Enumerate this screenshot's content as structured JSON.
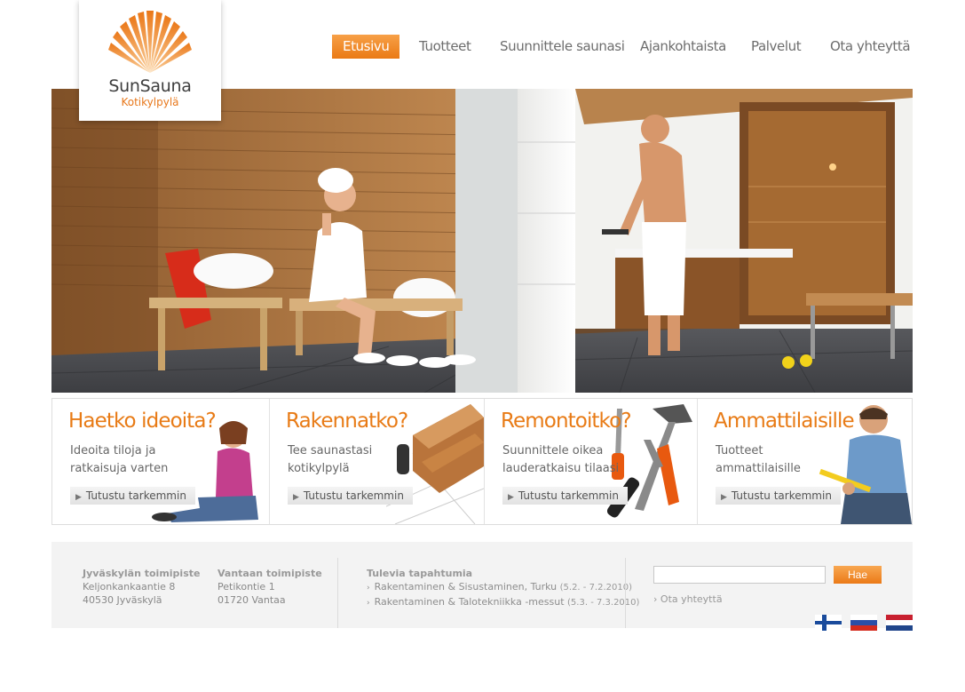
{
  "logo": {
    "brand": "SunSauna",
    "subtitle": "Kotikylpylä",
    "icon": "sun-fan-icon",
    "accent": "#ef8a26"
  },
  "nav": {
    "items": [
      {
        "label": "Etusivu",
        "active": true
      },
      {
        "label": "Tuotteet"
      },
      {
        "label": "Suunnittele saunasi"
      },
      {
        "label": "Ajankohtaista"
      },
      {
        "label": "Palvelut"
      },
      {
        "label": "Ota yhteyttä"
      }
    ]
  },
  "teasers": [
    {
      "title": "Haetko ideoita?",
      "desc_line1": "Ideoita tiloja ja",
      "desc_line2": "ratkaisuja varten",
      "button": "Tutustu tarkemmin"
    },
    {
      "title": "Rakennatko?",
      "desc_line1": "Tee saunastasi",
      "desc_line2": "kotikylpylä",
      "button": "Tutustu tarkemmin"
    },
    {
      "title": "Remontoitko?",
      "desc_line1": "Suunnittele oikea",
      "desc_line2": "lauderatkaisu tilaasi",
      "button": "Tutustu tarkemmin"
    },
    {
      "title": "Ammattilaisille",
      "desc_line1": "Tuotteet",
      "desc_line2": "ammattilaisille",
      "button": "Tutustu tarkemmin"
    }
  ],
  "footer": {
    "office1": {
      "heading": "Jyväskylän toimipiste",
      "street": "Keljonkankaantie 8",
      "city": "40530 Jyväskylä"
    },
    "office2": {
      "heading": "Vantaan toimipiste",
      "street": "Petikontie 1",
      "city": "01720 Vantaa"
    },
    "events": {
      "heading": "Tulevia tapahtumia",
      "items": [
        {
          "name": "Rakentaminen & Sisustaminen, Turku",
          "date": "(5.2. - 7.2.2010)"
        },
        {
          "name": "Rakentaminen & Talotekniikka -messut",
          "date": "(5.3. - 7.3.2010)"
        }
      ]
    },
    "search": {
      "value": "",
      "placeholder": "",
      "button": "Hae"
    },
    "contact_link": "Ota yhteyttä"
  },
  "flags": [
    "finnish-flag-icon",
    "russian-flag-icon",
    "dutch-flag-icon"
  ]
}
